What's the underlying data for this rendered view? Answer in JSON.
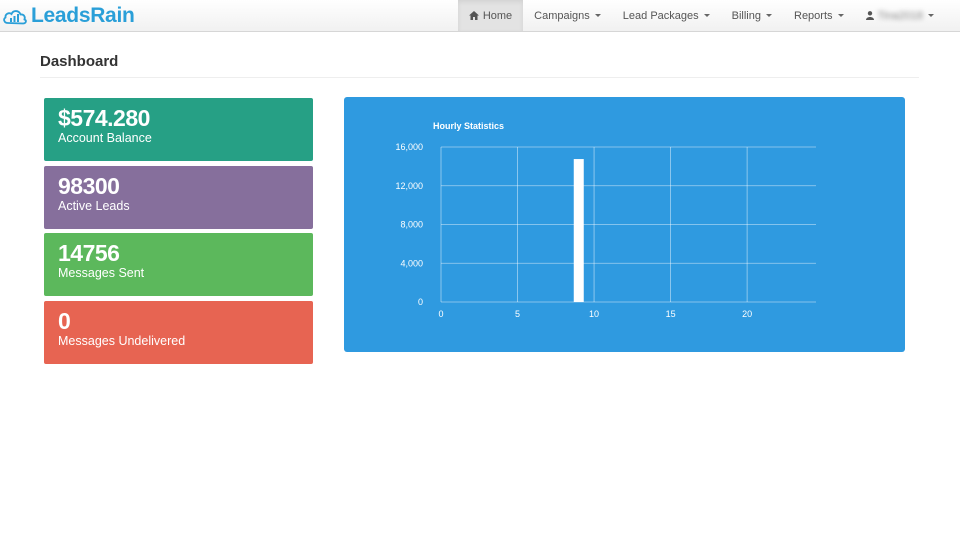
{
  "brand": {
    "name": "LeadsRain",
    "color": "#2a9fd8"
  },
  "nav": {
    "items": [
      {
        "label": "Home",
        "icon": "home-icon",
        "active": true,
        "dropdown": false
      },
      {
        "label": "Campaigns",
        "dropdown": true
      },
      {
        "label": "Lead Packages",
        "dropdown": true
      },
      {
        "label": "Billing",
        "dropdown": true
      },
      {
        "label": "Reports",
        "dropdown": true
      }
    ],
    "user": {
      "icon": "user-icon",
      "name": "Tina2018"
    }
  },
  "page": {
    "title": "Dashboard"
  },
  "stats": [
    {
      "value": "$574.280",
      "label": "Account Balance",
      "color": "#26a085"
    },
    {
      "value": "98300",
      "label": "Active Leads",
      "color": "#866f9c"
    },
    {
      "value": "14756",
      "label": "Messages Sent",
      "color": "#5cb85c"
    },
    {
      "value": "0",
      "label": "Messages Undelivered",
      "color": "#e76452"
    }
  ],
  "chart_data": {
    "type": "bar",
    "title": "Hourly Statistics",
    "xlabel": "",
    "ylabel": "",
    "x": [
      9
    ],
    "values": [
      14756
    ],
    "xlim": [
      0,
      24.5
    ],
    "ylim": [
      0,
      16000
    ],
    "xticks": [
      0,
      5,
      10,
      15,
      20
    ],
    "yticks": [
      0,
      4000,
      8000,
      12000,
      16000
    ],
    "ytick_labels": [
      "0",
      "4,000",
      "8,000",
      "12,000",
      "16,000"
    ],
    "grid": true,
    "background": "#2f9ae0",
    "bar_color": "#ffffff"
  }
}
